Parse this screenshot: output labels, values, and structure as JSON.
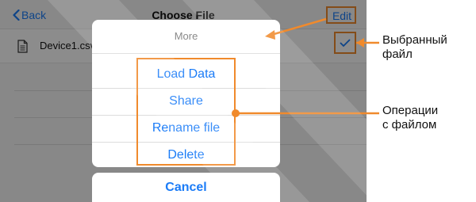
{
  "navbar": {
    "back_label": "Back",
    "title": "Choose File",
    "edit_label": "Edit"
  },
  "file_list": [
    {
      "name": "Device1.csv",
      "selected": true,
      "icon": "document-icon"
    }
  ],
  "action_sheet": {
    "title": "More",
    "items": [
      "Load Data",
      "Share",
      "Rename file",
      "Delete"
    ],
    "cancel_label": "Cancel"
  },
  "annotations": {
    "selected_file": {
      "line1": "Выбранный",
      "line2": "файл"
    },
    "file_operations": {
      "line1": "Операции",
      "line2": "с файлом"
    }
  },
  "colors": {
    "accent": "#1b7cf7",
    "highlight": "#f08a2c",
    "dim_overlay": "rgba(0,0,0,0.45)"
  }
}
